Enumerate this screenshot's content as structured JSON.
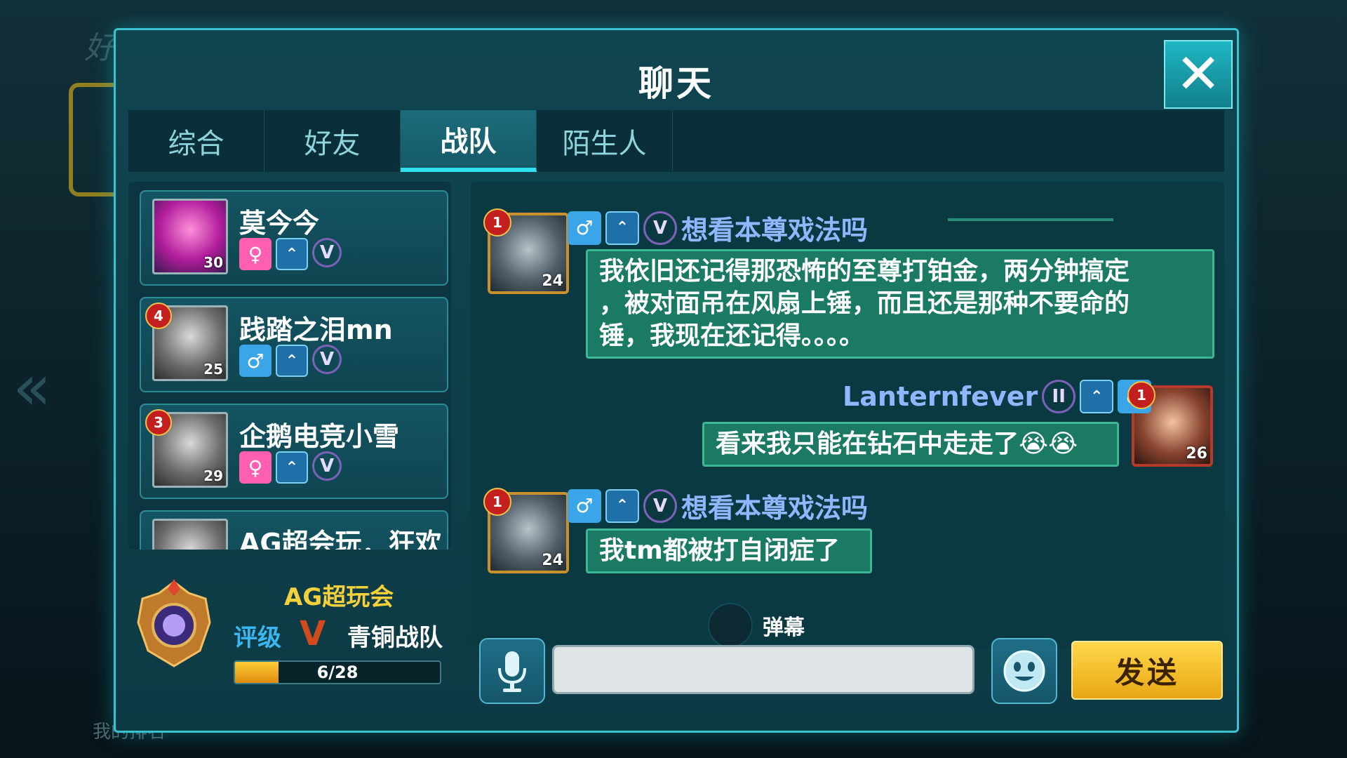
{
  "background": {
    "title": "好友天梯排行",
    "my_rank_label": "我的排名"
  },
  "dialog": {
    "title": "聊天",
    "close_icon": "close-icon"
  },
  "tabs": [
    {
      "label": "综合",
      "active": false
    },
    {
      "label": "好友",
      "active": false
    },
    {
      "label": "战队",
      "active": true
    },
    {
      "label": "陌生人",
      "active": false
    }
  ],
  "contacts": [
    {
      "name": "莫今今",
      "level": "30",
      "rank": "",
      "gender": "female"
    },
    {
      "name": "践踏之泪mn",
      "level": "25",
      "rank": "4",
      "gender": "male"
    },
    {
      "name": "企鹅电竞小雪",
      "level": "29",
      "rank": "3",
      "gender": "female"
    },
    {
      "name": "AG超会玩．狂欢",
      "level": "",
      "rank": "",
      "gender": ""
    }
  ],
  "team": {
    "name": "AG超玩会",
    "rating_label": "评级",
    "tier": "青铜战队",
    "progress_text": "6/28",
    "progress_fraction": 0.214
  },
  "messages": [
    {
      "sender": "想看本尊戏法吗",
      "level": "24",
      "rank": "1",
      "side": "left",
      "lines": [
        "我依旧还记得那恐怖的至尊打铂金，两分钟搞定",
        "，被对面吊在风扇上锤，而且还是那种不要命的",
        "锤，我现在还记得。。。。"
      ]
    },
    {
      "sender": "Lanternfever",
      "level": "26",
      "rank": "1",
      "side": "right",
      "lines": [
        "看来我只能在钻石中走走了😭😭"
      ]
    },
    {
      "sender": "想看本尊戏法吗",
      "level": "24",
      "rank": "1",
      "side": "left",
      "lines": [
        "我tm都被打自闭症了"
      ]
    }
  ],
  "danmu_label": "弹幕",
  "input": {
    "value": "",
    "placeholder": ""
  },
  "send_label": "发送",
  "colors": {
    "accent": "#39c3cf",
    "bubble": "#1b7a63",
    "send": "#f2b828",
    "sender_name": "#8fb7ff"
  }
}
